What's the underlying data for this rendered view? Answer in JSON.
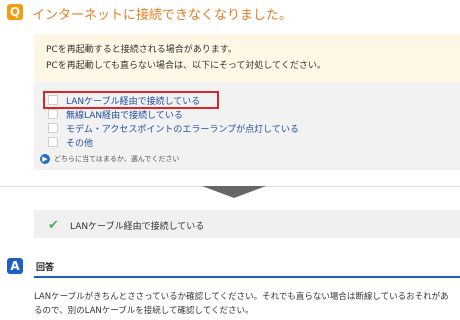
{
  "question": {
    "badge": "Q",
    "title": "インターネットに接続できなくなりました。"
  },
  "info": {
    "line1": "PCを再起動すると接続される場合があります。",
    "line2": "PCを再起動しても直らない場合は、以下にそって対処してください。"
  },
  "options": [
    {
      "label": "LANケーブル経由で接続している"
    },
    {
      "label": "無線LAN経由で接続している"
    },
    {
      "label": "モデム・アクセスポイントのエラーランプが点灯している"
    },
    {
      "label": "その他"
    }
  ],
  "hint": {
    "text": "どちらに当てはまるか、選んでください"
  },
  "selected": {
    "label": "LANケーブル経由で接続している"
  },
  "answer": {
    "badge": "A",
    "title": "回答",
    "text": "LANケーブルがきちんとささっているか確認してください。それでも直らない場合は断線しているおそれがあるので、別のLANケーブルを接続して確認してください。"
  },
  "colors": {
    "question_accent": "#e67e22",
    "option_link": "#1f4fa3",
    "highlight_border": "#d62828",
    "answer_accent": "#1f5fbf",
    "check_color": "#4caf50"
  }
}
